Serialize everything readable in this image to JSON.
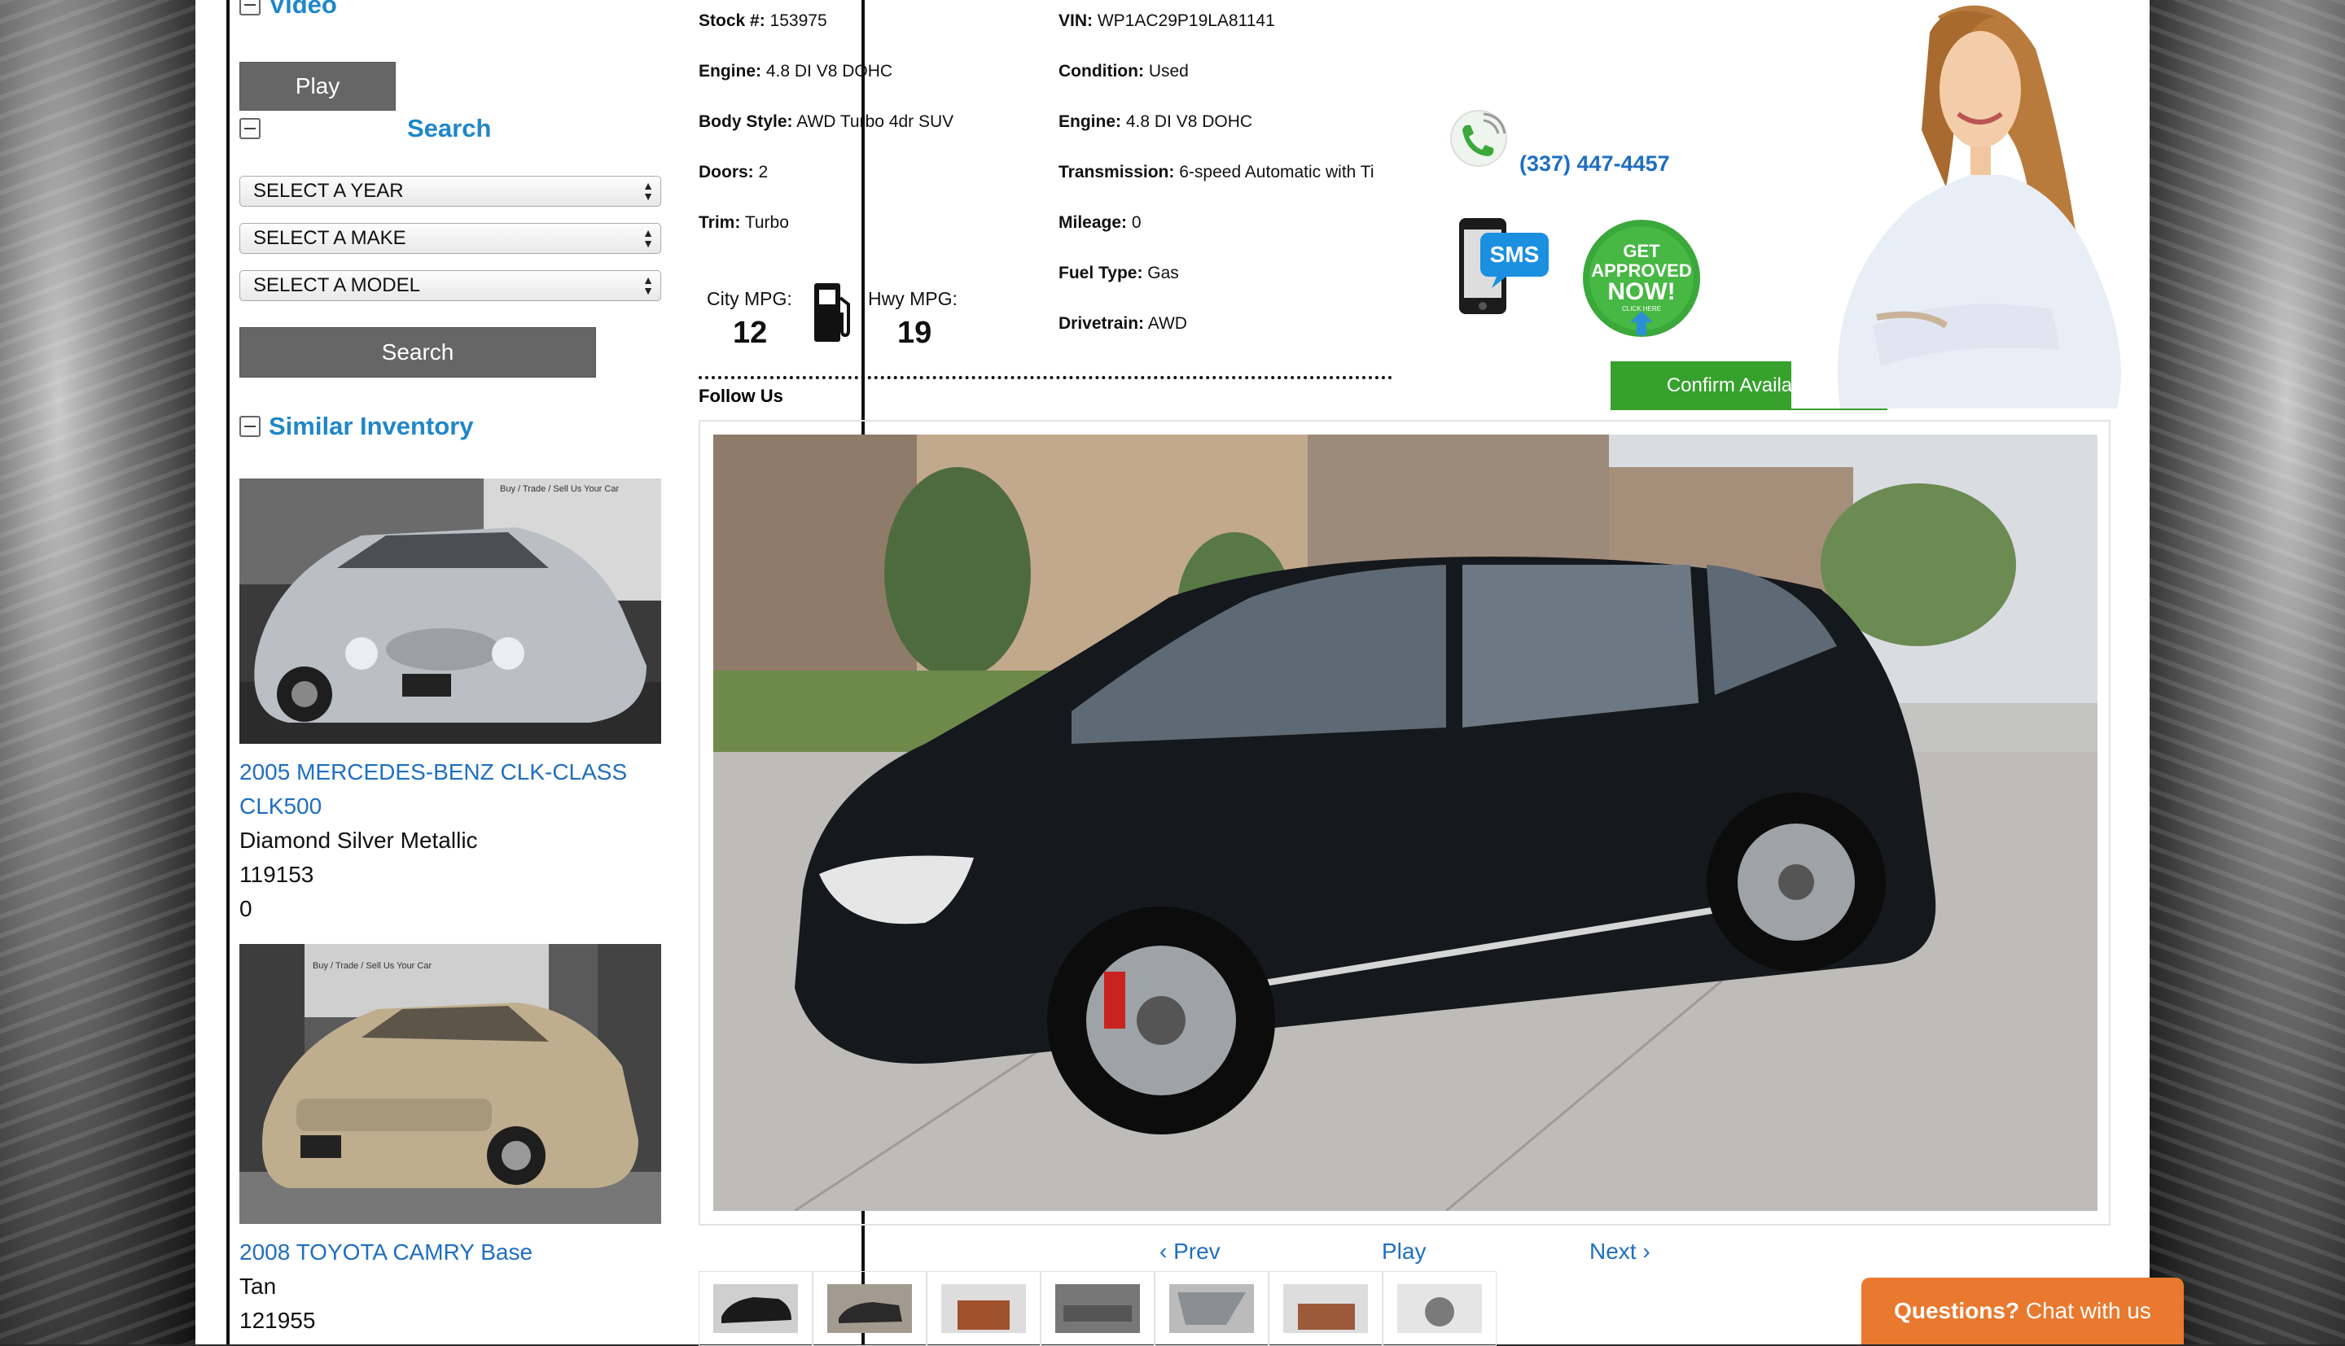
{
  "sidebar": {
    "video": {
      "title": "Video",
      "play_label": "Play"
    },
    "search": {
      "title": "Search",
      "year_select": "SELECT A YEAR",
      "make_select": "SELECT A MAKE",
      "model_select": "SELECT A MODEL",
      "button_label": "Search"
    },
    "similar": {
      "title": "Similar Inventory",
      "cars": [
        {
          "title": "2005 MERCEDES-BENZ CLK-CLASS CLK500",
          "color": "Diamond Silver Metallic",
          "mileage": "119153",
          "price": "0",
          "banner": "Buy / Trade / Sell Us Your Car"
        },
        {
          "title": "2008 TOYOTA CAMRY Base",
          "color": "Tan",
          "mileage": "121955",
          "banner": "Buy / Trade / Sell Us Your Car"
        }
      ]
    }
  },
  "specs": {
    "stock_label": "Stock #:",
    "stock": "153975",
    "engine_label": "Engine:",
    "engine": "4.8 DI V8 DOHC",
    "body_label": "Body Style:",
    "body": "AWD Turbo 4dr SUV",
    "doors_label": "Doors:",
    "doors": "2",
    "trim_label": "Trim:",
    "trim": "Turbo",
    "vin_label": "VIN:",
    "vin": "WP1AC29P19LA81141",
    "condition_label": "Condition:",
    "condition": "Used",
    "engine2_label": "Engine:",
    "engine2": "4.8 DI V8 DOHC",
    "transmission_label": "Transmission:",
    "transmission": "6-speed Automatic with Ti",
    "mileage_label": "Mileage:",
    "mileage": "0",
    "fuel_label": "Fuel Type:",
    "fuel": "Gas",
    "drivetrain_label": "Drivetrain:",
    "drivetrain": "AWD"
  },
  "mpg": {
    "city_label": "City MPG:",
    "city": "12",
    "hwy_label": "Hwy MPG:",
    "hwy": "19"
  },
  "contact": {
    "phone": "(337) 447-4457",
    "sms_label": "SMS",
    "approved_line1": "GET",
    "approved_line2": "APPROVED",
    "approved_line3": "NOW!",
    "approved_sub": "CLICK HERE",
    "confirm_label": "Confirm Availability"
  },
  "follow_label": "Follow Us",
  "gallery": {
    "prev": "‹ Prev",
    "play": "Play",
    "next": "Next ›",
    "thumb_count": 7
  },
  "chat": {
    "bold": "Questions?",
    "text": "Chat with us"
  },
  "colors": {
    "accent": "#1f87c9",
    "link": "#1f6fc0",
    "confirm": "#37a12e",
    "chat": "#e9792e"
  },
  "icons": [
    "collapse-icon",
    "phone-icon",
    "sms-phone-icon",
    "gas-pump-icon",
    "select-arrows-icon"
  ]
}
